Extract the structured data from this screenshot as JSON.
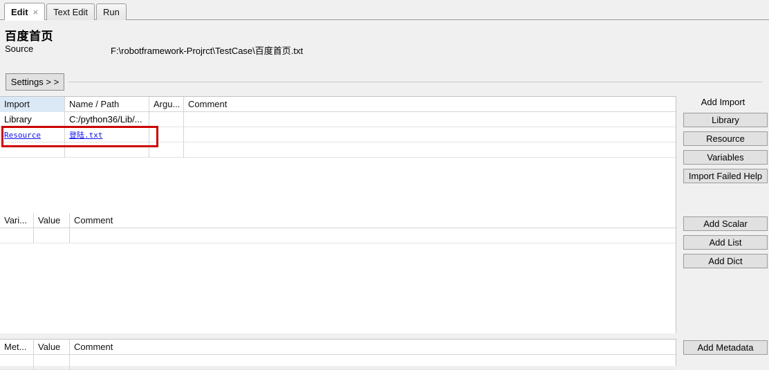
{
  "window": {
    "tabs": [
      {
        "label": "Edit",
        "active": true,
        "closable": true,
        "close_glyph": "×"
      },
      {
        "label": "Text Edit",
        "active": false,
        "closable": false
      },
      {
        "label": "Run",
        "active": false,
        "closable": false
      }
    ]
  },
  "header": {
    "title": "百度首页",
    "source_label": "Source",
    "source_value": "F:\\robotframework-Projrct\\TestCase\\百度首页.txt"
  },
  "toolbar": {
    "settings_label": "Settings  > >"
  },
  "imports_table": {
    "columns": [
      "Import",
      "Name / Path",
      "Argu...",
      "Comment"
    ],
    "rows": [
      {
        "type": "Library",
        "name_path": "C:/python36/Lib/...",
        "args": "",
        "comment": "",
        "is_link": false
      },
      {
        "type": "Resource",
        "name_path": "登陆.txt",
        "args": "",
        "comment": "",
        "is_link": true
      }
    ]
  },
  "variables_table": {
    "columns": [
      "Vari...",
      "Value",
      "Comment"
    ],
    "rows": []
  },
  "metadata_table": {
    "columns": [
      "Met...",
      "Value",
      "Comment"
    ],
    "rows": []
  },
  "sidebar": {
    "add_import_title": "Add Import",
    "import_buttons": [
      "Library",
      "Resource",
      "Variables",
      "Import Failed Help"
    ],
    "variable_buttons": [
      "Add Scalar",
      "Add List",
      "Add Dict"
    ],
    "metadata_button": "Add Metadata"
  },
  "annotation": {
    "color": "#cc0000",
    "shape": "rectangle"
  },
  "colors": {
    "header_highlight": "#dbe9f7",
    "link": "#1010ee",
    "button_face": "#e1e1e1",
    "panel_background": "#f0f0f0",
    "grid_background": "#ffffff"
  }
}
